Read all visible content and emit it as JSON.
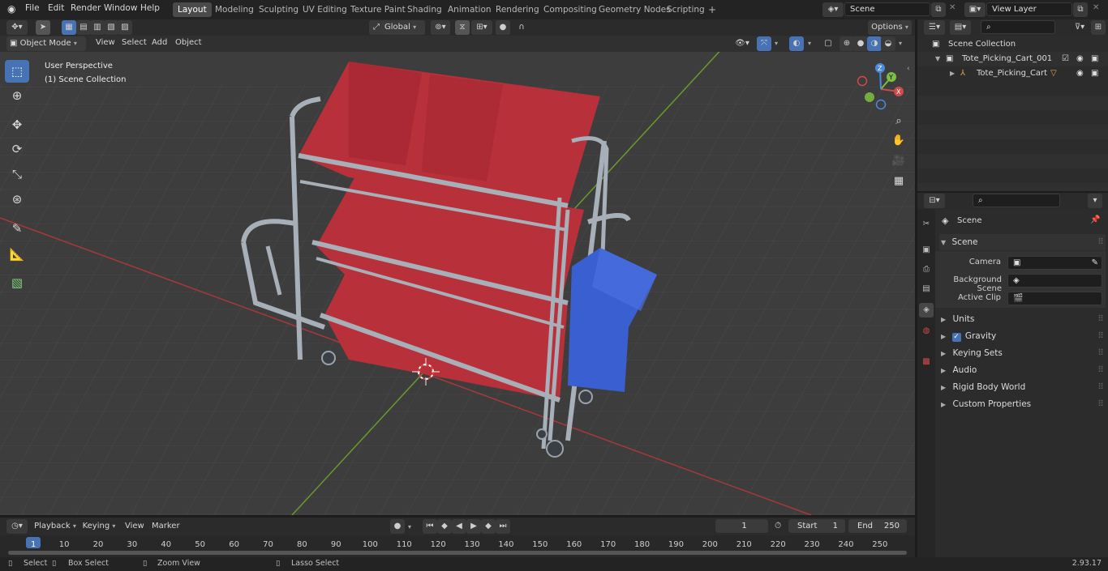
{
  "topbar": {
    "menu": [
      "File",
      "Edit",
      "Render",
      "Window",
      "Help"
    ],
    "workspaces": [
      "Layout",
      "Modeling",
      "Sculpting",
      "UV Editing",
      "Texture Paint",
      "Shading",
      "Animation",
      "Rendering",
      "Compositing",
      "Geometry Nodes",
      "Scripting"
    ],
    "active_workspace": "Layout",
    "add_tab": "+",
    "scene_name": "Scene",
    "view_layer": "View Layer"
  },
  "viewport_header": {
    "mode": "Object Mode",
    "menus": [
      "View",
      "Select",
      "Add",
      "Object"
    ],
    "transform_orientation": "Global",
    "options": "Options"
  },
  "viewport": {
    "perspective_label": "User Perspective",
    "collection_label": "(1) Scene Collection",
    "gizmo_axes": [
      "X",
      "Y",
      "Z"
    ]
  },
  "outliner": {
    "root": "Scene Collection",
    "items": [
      {
        "name": "Tote_Picking_Cart_001",
        "level": 1
      },
      {
        "name": "Tote_Picking_Cart",
        "level": 2
      }
    ]
  },
  "properties": {
    "context": "Scene",
    "panel_title": "Scene",
    "fields": [
      {
        "label": "Camera",
        "value": ""
      },
      {
        "label": "Background Scene",
        "value": ""
      },
      {
        "label": "Active Clip",
        "value": ""
      }
    ],
    "sections": [
      "Units",
      "Gravity",
      "Keying Sets",
      "Audio",
      "Rigid Body World",
      "Custom Properties"
    ],
    "gravity_checked": true
  },
  "timeline": {
    "menus": [
      "Playback",
      "Keying",
      "View",
      "Marker"
    ],
    "current_frame": "1",
    "start_label": "Start",
    "start": "1",
    "end_label": "End",
    "end": "250",
    "ticks": [
      "1",
      "10",
      "20",
      "30",
      "40",
      "50",
      "60",
      "70",
      "80",
      "90",
      "100",
      "110",
      "120",
      "130",
      "140",
      "150",
      "160",
      "170",
      "180",
      "190",
      "200",
      "210",
      "220",
      "230",
      "240",
      "250"
    ]
  },
  "statusbar": {
    "hints": [
      "Select",
      "Box Select",
      "Zoom View",
      "Lasso Select"
    ],
    "version": "2.93.17"
  },
  "colors": {
    "accent": "#4772b3",
    "tote_red": "#b8303a",
    "tote_blue": "#3a5fd0",
    "frame": "#a7afb8",
    "axis_x": "#c0392b",
    "axis_y": "#6a9a2a"
  }
}
